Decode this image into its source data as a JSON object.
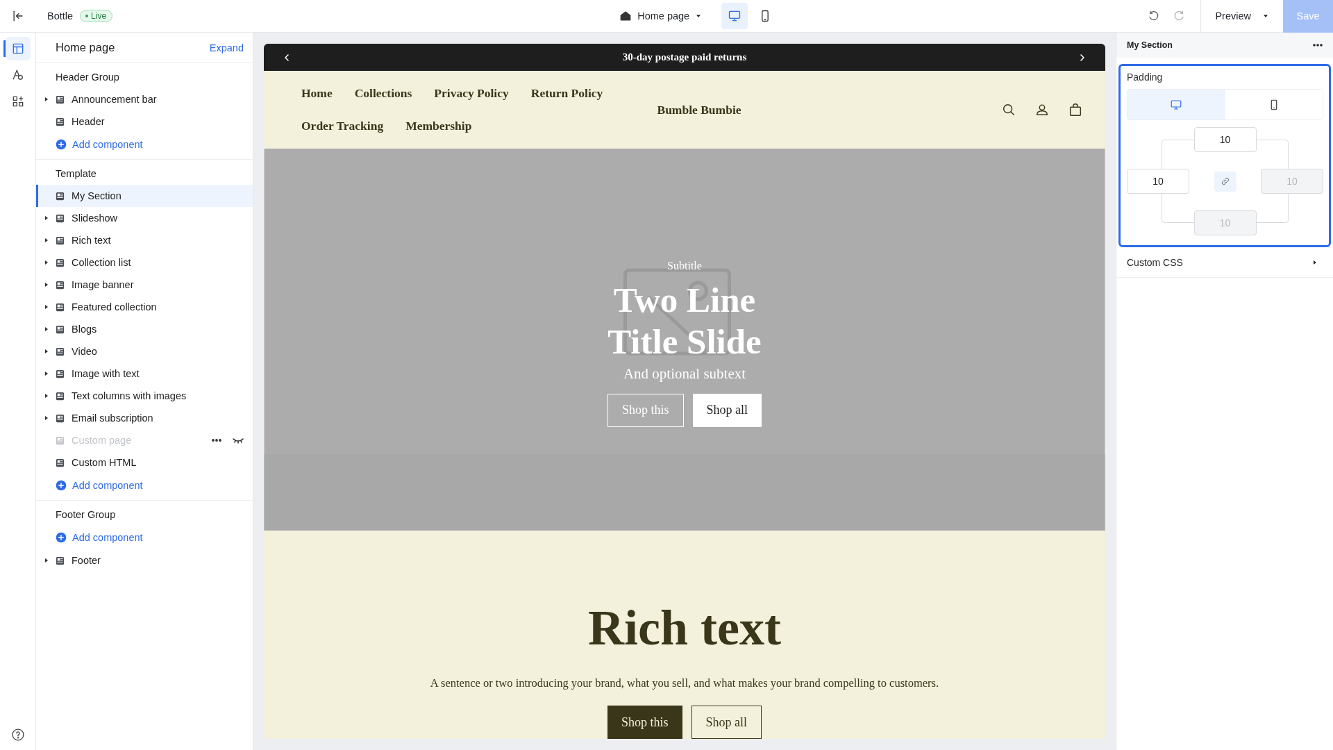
{
  "topbar": {
    "site": "Bottle",
    "status": "Live",
    "page": "Home page",
    "devices": [
      {
        "kind": "desktop",
        "selected": true
      },
      {
        "kind": "mobile",
        "selected": false
      }
    ],
    "preview": "Preview",
    "save": {
      "label": "Save",
      "disabled": true
    }
  },
  "rail": {
    "items": [
      {
        "kind": "layout",
        "selected": true
      },
      {
        "kind": "theme",
        "selected": false
      },
      {
        "kind": "apps",
        "selected": false
      }
    ]
  },
  "sidebar": {
    "title": "Home page",
    "action": "Expand",
    "groups": [
      {
        "label": "Header Group",
        "rows": [
          {
            "kind": "item",
            "label": "Announcement bar",
            "expandable": true,
            "selected": false,
            "hidden": false
          },
          {
            "kind": "item",
            "label": "Header",
            "expandable": false,
            "selected": false,
            "hidden": false
          },
          {
            "kind": "add",
            "label": "Add component"
          }
        ]
      },
      {
        "label": "Template",
        "rows": [
          {
            "kind": "item",
            "label": "My Section",
            "expandable": false,
            "selected": true,
            "hidden": false
          },
          {
            "kind": "item",
            "label": "Slideshow",
            "expandable": true,
            "selected": false,
            "hidden": false
          },
          {
            "kind": "item",
            "label": "Rich text",
            "expandable": true,
            "selected": false,
            "hidden": false
          },
          {
            "kind": "item",
            "label": "Collection list",
            "expandable": true,
            "selected": false,
            "hidden": false
          },
          {
            "kind": "item",
            "label": "Image banner",
            "expandable": true,
            "selected": false,
            "hidden": false
          },
          {
            "kind": "item",
            "label": "Featured collection",
            "expandable": true,
            "selected": false,
            "hidden": false
          },
          {
            "kind": "item",
            "label": "Blogs",
            "expandable": true,
            "selected": false,
            "hidden": false
          },
          {
            "kind": "item",
            "label": "Video",
            "expandable": true,
            "selected": false,
            "hidden": false
          },
          {
            "kind": "item",
            "label": "Image with text",
            "expandable": true,
            "selected": false,
            "hidden": false
          },
          {
            "kind": "item",
            "label": "Text columns with images",
            "expandable": true,
            "selected": false,
            "hidden": false
          },
          {
            "kind": "item",
            "label": "Email subscription",
            "expandable": true,
            "selected": false,
            "hidden": false
          },
          {
            "kind": "item",
            "label": "Custom page",
            "expandable": false,
            "selected": false,
            "hidden": true
          },
          {
            "kind": "item",
            "label": "Custom HTML",
            "expandable": false,
            "selected": false,
            "hidden": false
          },
          {
            "kind": "add",
            "label": "Add component"
          }
        ]
      },
      {
        "label": "Footer Group",
        "rows": [
          {
            "kind": "add",
            "label": "Add component"
          },
          {
            "kind": "item",
            "label": "Footer",
            "expandable": true,
            "selected": false,
            "hidden": false
          }
        ]
      }
    ]
  },
  "preview": {
    "announcement": "30-day postage paid returns",
    "nav": [
      "Home",
      "Collections",
      "Privacy Policy",
      "Return Policy",
      "Order Tracking",
      "Membership"
    ],
    "logo": "Bumble Bumbie",
    "hero": {
      "subtitle": "Subtitle",
      "title": "Two Line Title Slide",
      "subtext": "And optional subtext",
      "buttons": [
        {
          "label": "Shop this",
          "kind": "outline"
        },
        {
          "label": "Shop all",
          "kind": "solid"
        }
      ]
    },
    "rich_text": {
      "title": "Rich text",
      "text": "A sentence or two introducing your brand, what you sell, and what makes your brand compelling to customers.",
      "buttons": [
        {
          "label": "Shop this",
          "kind": "solid"
        },
        {
          "label": "Shop all",
          "kind": "outline"
        }
      ]
    }
  },
  "settings": {
    "title": "My Section",
    "padding": {
      "label": "Padding",
      "devices": [
        {
          "kind": "desktop",
          "selected": true
        },
        {
          "kind": "mobile",
          "selected": false
        }
      ],
      "top": {
        "value": "10",
        "disabled": false
      },
      "left": {
        "value": "10",
        "disabled": false
      },
      "right": {
        "value": "10",
        "disabled": true
      },
      "bottom": {
        "value": "10",
        "disabled": true
      }
    },
    "custom_css": {
      "label": "Custom CSS",
      "expanded": false
    }
  }
}
